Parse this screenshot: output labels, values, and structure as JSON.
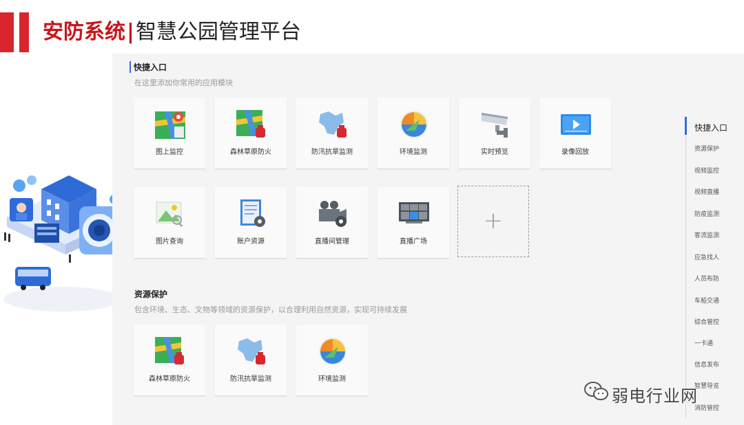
{
  "header": {
    "title_main": "安防系统",
    "separator": "|",
    "title_sub": "智慧公园管理平台"
  },
  "quick_entry": {
    "title": "快捷入口",
    "description": "在这里添加你常用的应用模块",
    "items": [
      {
        "label": "图上监控",
        "icon": "map-pin-icon"
      },
      {
        "label": "森林草原防火",
        "icon": "forest-fire-alarm-icon"
      },
      {
        "label": "防汛抗旱监测",
        "icon": "flood-drought-alarm-icon"
      },
      {
        "label": "环境监测",
        "icon": "environment-icon"
      },
      {
        "label": "实时预览",
        "icon": "cctv-camera-icon"
      },
      {
        "label": "录像回放",
        "icon": "video-playback-icon"
      },
      {
        "label": "图片查询",
        "icon": "image-search-icon"
      },
      {
        "label": "账户资源",
        "icon": "account-resource-icon"
      },
      {
        "label": "直播间管理",
        "icon": "live-room-camera-icon"
      },
      {
        "label": "直播广场",
        "icon": "live-plaza-icon"
      }
    ],
    "add_icon": "plus-icon"
  },
  "resource_protection": {
    "title": "资源保护",
    "description": "包含环境、生态、文物等领域的资源保护，以合理利用自然资源，实现可持续发展",
    "items": [
      {
        "label": "森林草原防火",
        "icon": "forest-fire-alarm-icon"
      },
      {
        "label": "防汛抗旱监测",
        "icon": "flood-drought-alarm-icon"
      },
      {
        "label": "环境监测",
        "icon": "environment-icon"
      }
    ]
  },
  "right_nav": {
    "items": [
      "快捷入口",
      "资源保护",
      "视频监控",
      "视频直播",
      "防疫监测",
      "客流监测",
      "应急找人",
      "人员布防",
      "车船交通",
      "综合管控",
      "一卡通",
      "信息发布",
      "智慧导览",
      "消防管控"
    ],
    "active_index": 0
  },
  "watermark": {
    "text": "弱电行业网",
    "icon": "wechat-icon"
  },
  "colors": {
    "brand_red": "#c8151b",
    "accent_blue": "#2f6bd8",
    "panel_bg": "#f4f4f4"
  }
}
